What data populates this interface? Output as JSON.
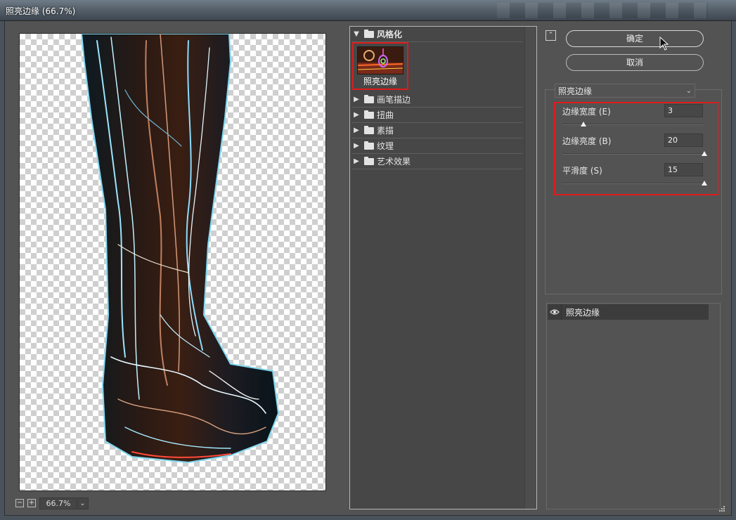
{
  "window": {
    "title": "照亮边缘 (66.7%)"
  },
  "preview": {
    "zoom": "66.7%"
  },
  "gallery": {
    "open_category": "风格化",
    "selected_filter": "照亮边缘",
    "categories": [
      "画笔描边",
      "扭曲",
      "素描",
      "纹理",
      "艺术效果"
    ]
  },
  "buttons": {
    "ok": "确定",
    "cancel": "取消"
  },
  "settings": {
    "filter": "照亮边缘",
    "params": [
      {
        "label": "边缘宽度 (E)",
        "value": "3",
        "level": 0.15
      },
      {
        "label": "边缘亮度 (B)",
        "value": "20",
        "level": 1.0
      },
      {
        "label": "平滑度 (S)",
        "value": "15",
        "level": 1.0
      }
    ]
  },
  "layers": {
    "items": [
      "照亮边缘"
    ]
  },
  "colors": {
    "highlight": "#e01b1b",
    "panel": "#535353"
  }
}
